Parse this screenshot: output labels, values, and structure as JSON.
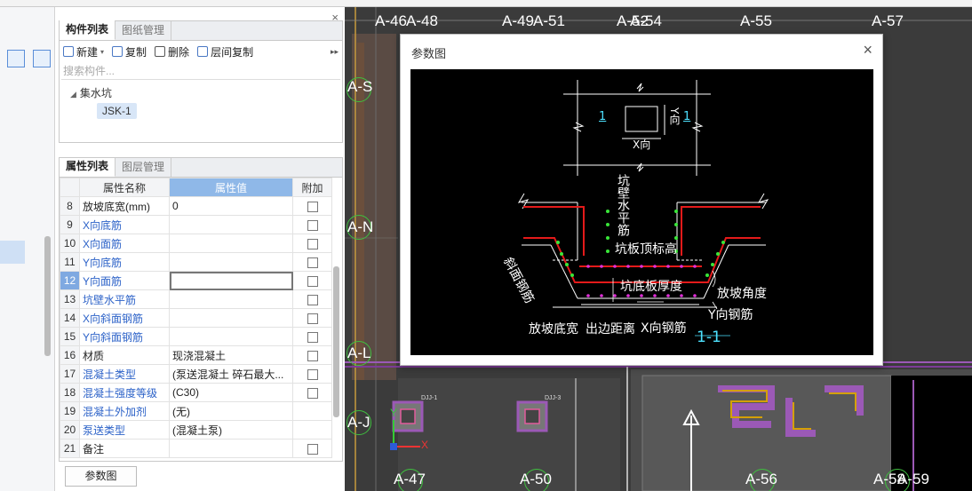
{
  "component_panel": {
    "tabs": [
      "构件列表",
      "图纸管理"
    ],
    "toolbar": {
      "new": "新建",
      "copy": "复制",
      "delete": "删除",
      "floor_copy": "层间复制",
      "more": "▸▸"
    },
    "search_placeholder": "搜索构件...",
    "tree": {
      "category": "集水坑",
      "item": "JSK-1"
    }
  },
  "property_panel": {
    "tabs": [
      "属性列表",
      "图层管理"
    ],
    "columns": {
      "name": "属性名称",
      "value": "属性值",
      "extra": "附加"
    },
    "rows": [
      {
        "no": "8",
        "name": "放坡底宽(mm)",
        "value": "0",
        "check": true
      },
      {
        "no": "9",
        "name": "X向底筋",
        "value": "",
        "check": true
      },
      {
        "no": "10",
        "name": "X向面筋",
        "value": "",
        "check": true
      },
      {
        "no": "11",
        "name": "Y向底筋",
        "value": "",
        "check": true
      },
      {
        "no": "12",
        "name": "Y向面筋",
        "value": "",
        "check": true
      },
      {
        "no": "13",
        "name": "坑壁水平筋",
        "value": "",
        "check": true
      },
      {
        "no": "14",
        "name": "X向斜面钢筋",
        "value": "",
        "check": true
      },
      {
        "no": "15",
        "name": "Y向斜面钢筋",
        "value": "",
        "check": true
      },
      {
        "no": "16",
        "name": "材质",
        "value": "现浇混凝土",
        "check": true
      },
      {
        "no": "17",
        "name": "混凝土类型",
        "value": "(泵送混凝土 碎石最大...",
        "check": true
      },
      {
        "no": "18",
        "name": "混凝土强度等级",
        "value": "(C30)",
        "check": true
      },
      {
        "no": "19",
        "name": "混凝土外加剂",
        "value": "(无)",
        "check": false
      },
      {
        "no": "20",
        "name": "泵送类型",
        "value": "(混凝土泵)",
        "check": false
      },
      {
        "no": "21",
        "name": "备注",
        "value": "",
        "check": true
      }
    ],
    "selected_row": "12",
    "bottom_button": "参数图"
  },
  "dialog": {
    "title": "参数图",
    "close": "×",
    "labels": {
      "x_dir": "X向",
      "y_dir": "Y向",
      "mark": "1",
      "wall_rebar": "坑壁水平筋",
      "top_elev": "坑板顶标高",
      "bottom_thk": "坑底板厚度",
      "slope_angle": "放坡角度",
      "y_rebar": "Y向钢筋",
      "x_rebar": "X向钢筋",
      "slope_width": "放坡底宽",
      "edge_dist": "出边距离",
      "slope_rebar": "斜面钢筋",
      "section": "1-1"
    }
  },
  "cad": {
    "grid_top": [
      "A-46",
      "A-48",
      "A-49",
      "A-51",
      "A-52",
      "A-54",
      "A-55",
      "A-57"
    ],
    "grid_left": [
      "A-S",
      "A-N",
      "A-L",
      "A-J"
    ],
    "grid_bottom": [
      "A-47",
      "A-50",
      "A-56",
      "A-58",
      "A-59"
    ],
    "small_tags": [
      "DJJ-1",
      "DJJ-3"
    ],
    "axis": {
      "x": "X",
      "y": "Y"
    }
  }
}
